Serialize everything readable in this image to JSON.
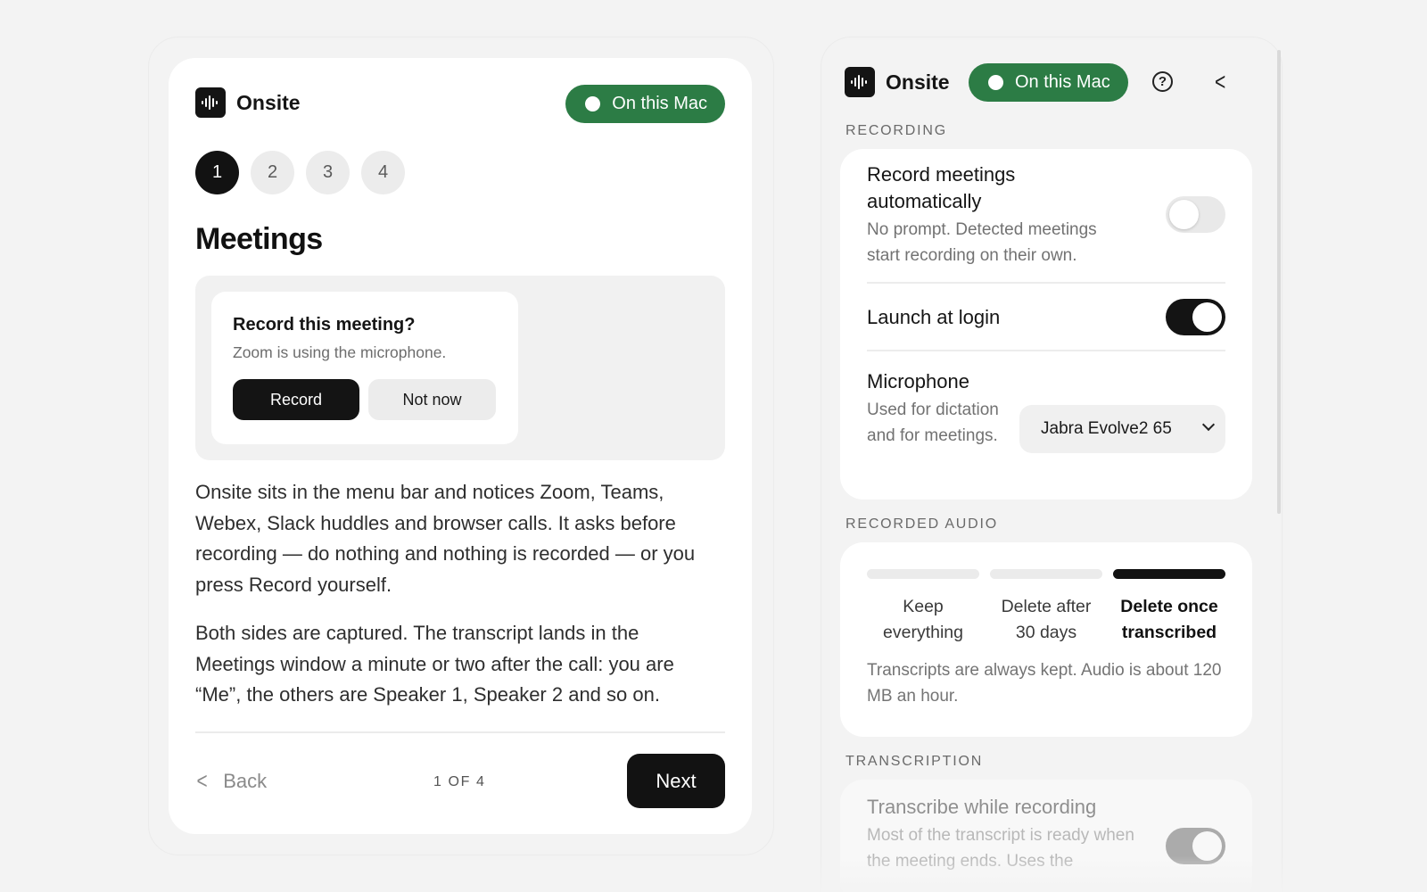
{
  "app": {
    "name": "Onsite",
    "logo_icon": "waveform-icon"
  },
  "status_pill": {
    "label": "On this Mac",
    "color": "#2c7c45"
  },
  "onboarding": {
    "steps": [
      "1",
      "2",
      "3",
      "4"
    ],
    "active_step": 1,
    "title": "Meetings",
    "prompt": {
      "title": "Record this meeting?",
      "subtitle": "Zoom is using the microphone.",
      "record_label": "Record",
      "not_now_label": "Not now"
    },
    "paragraphs": [
      "Onsite sits in the menu bar and notices Zoom, Teams, Webex, Slack huddles and browser calls. It asks before recording — do nothing and nothing is recorded — or you press Record yourself.",
      "Both sides are captured. The transcript lands in the Meetings window a minute or two after the call: you are “Me”, the others are Speaker 1, Speaker 2 and so on."
    ],
    "back_label": "Back",
    "page_indicator": "1 OF 4",
    "next_label": "Next"
  },
  "settings": {
    "recording": {
      "section_label": "RECORDING",
      "auto_record": {
        "title": "Record meetings automatically",
        "subtitle": "No prompt. Detected meetings start recording on their own.",
        "enabled": false
      },
      "launch_at_login": {
        "title": "Launch at login",
        "enabled": true
      },
      "microphone": {
        "title": "Microphone",
        "subtitle": "Used for dictation and for meetings.",
        "selected": "Jabra Evolve2 65"
      }
    },
    "recorded_audio": {
      "section_label": "RECORDED AUDIO",
      "options": [
        "Keep everything",
        "Delete after 30 days",
        "Delete once transcribed"
      ],
      "selected_index": 2,
      "note": "Transcripts are always kept. Audio is about 120 MB an hour."
    },
    "transcription": {
      "section_label": "TRANSCRIPTION",
      "while_recording": {
        "title": "Transcribe while recording",
        "subtitle": "Most of the transcript is ready when the meeting ends. Uses the",
        "enabled": true
      }
    }
  }
}
